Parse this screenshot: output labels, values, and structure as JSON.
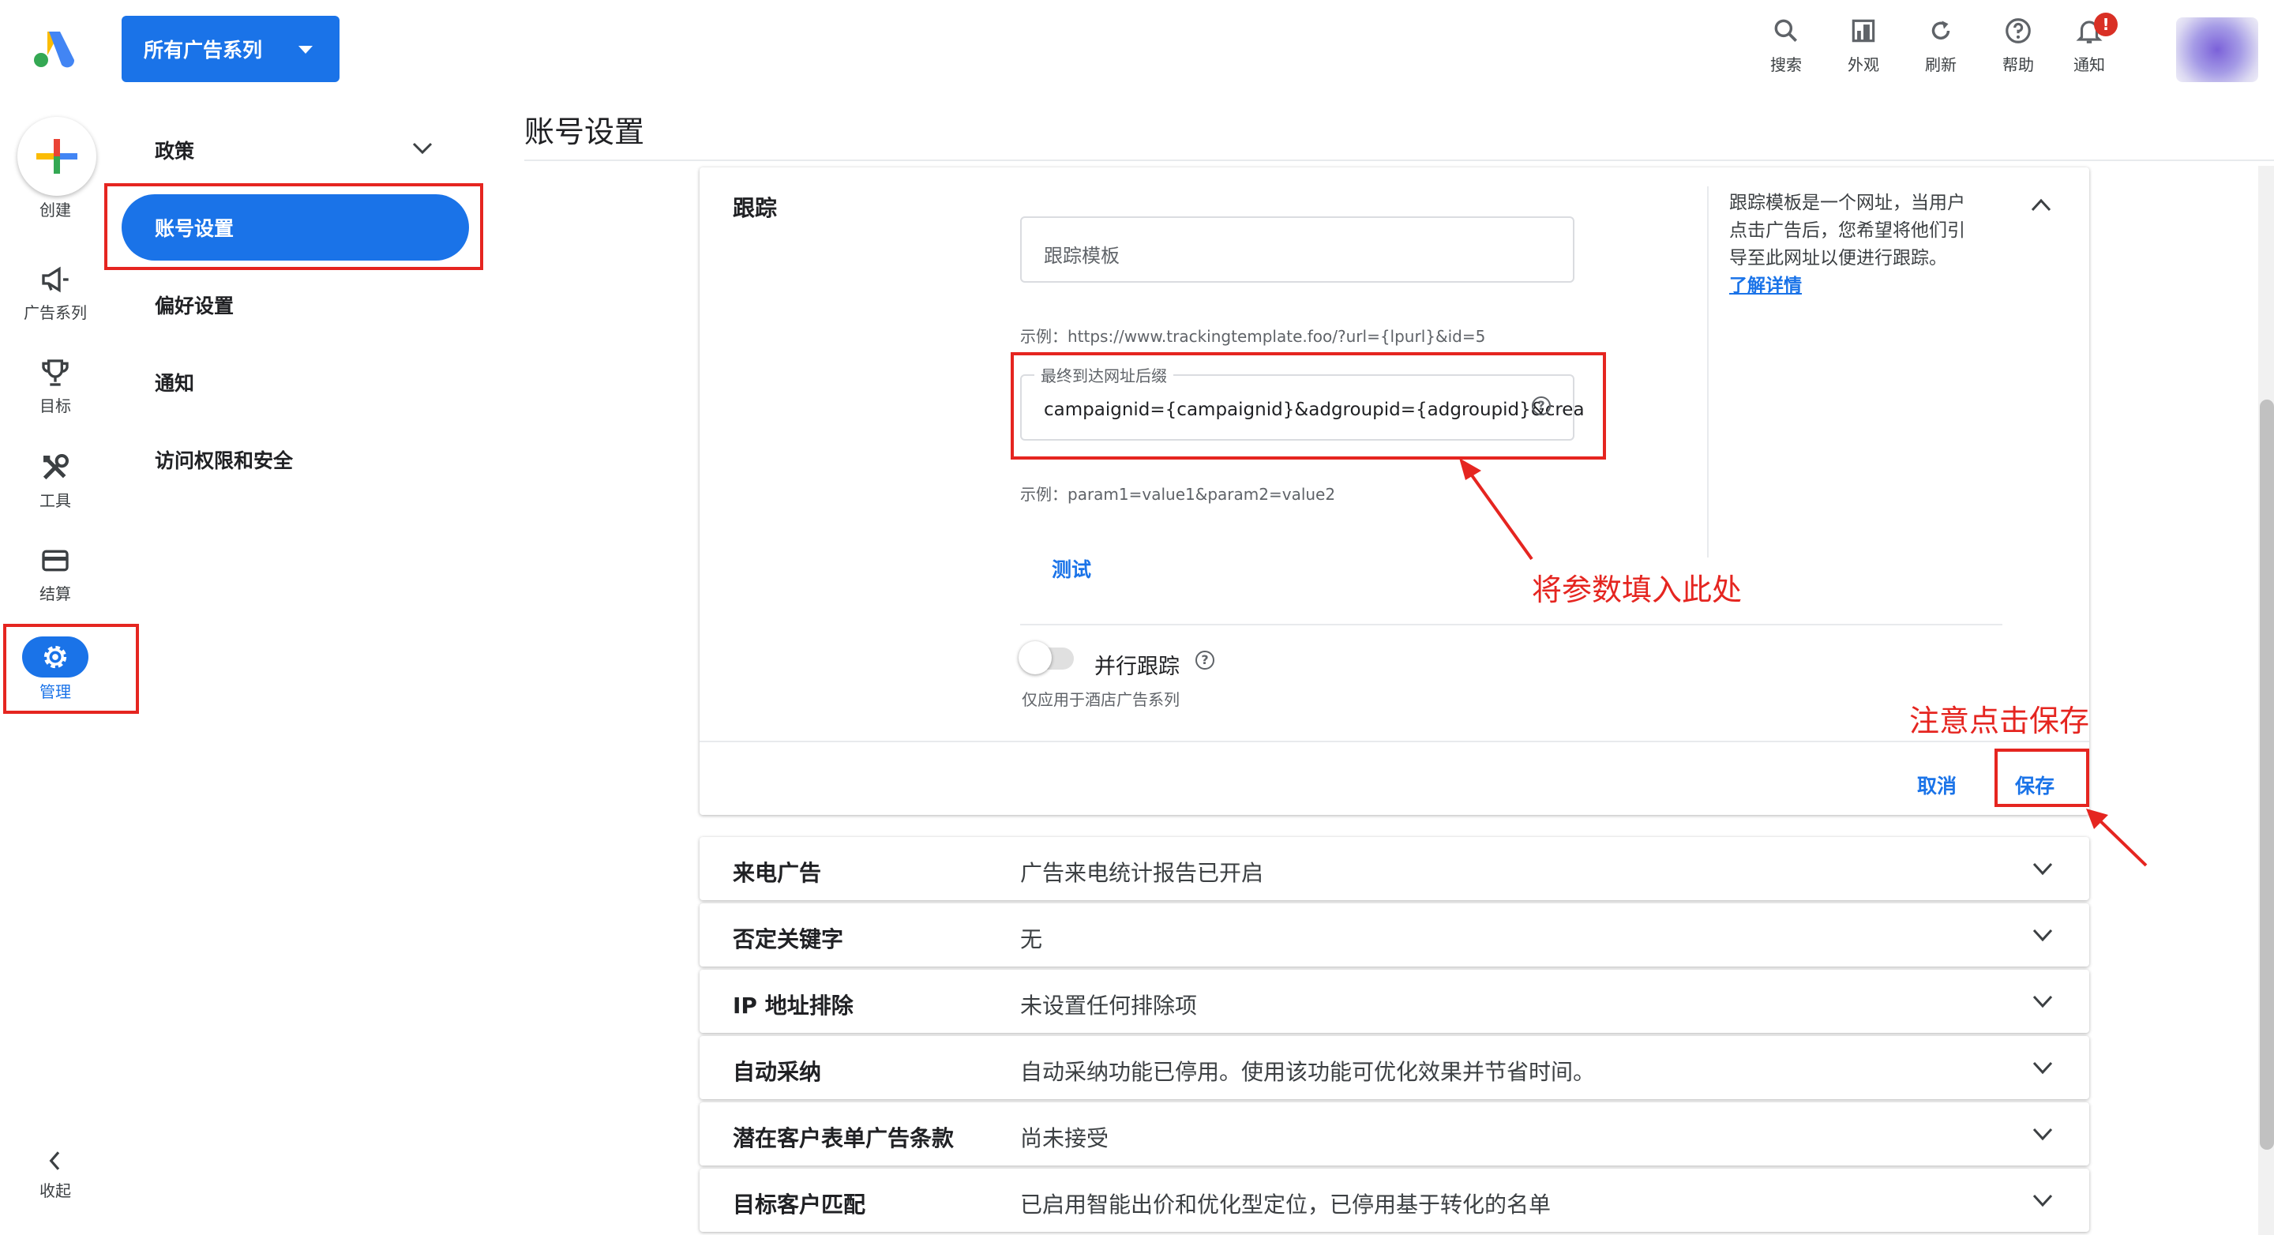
{
  "header": {
    "campaign_selector": "所有广告系列",
    "tools": [
      {
        "label": "搜索",
        "icon": "search-icon"
      },
      {
        "label": "外观",
        "icon": "appearance-icon"
      },
      {
        "label": "刷新",
        "icon": "refresh-icon"
      },
      {
        "label": "帮助",
        "icon": "help-icon"
      },
      {
        "label": "通知",
        "icon": "bell-icon"
      }
    ],
    "notification_badge": "!"
  },
  "rail": {
    "create": "创建",
    "items": [
      {
        "label": "广告系列",
        "icon": "megaphone-icon"
      },
      {
        "label": "目标",
        "icon": "trophy-icon"
      },
      {
        "label": "工具",
        "icon": "tools-icon"
      },
      {
        "label": "结算",
        "icon": "credit-card-icon"
      },
      {
        "label": "管理",
        "icon": "gear-icon"
      }
    ],
    "collapse": "收起"
  },
  "subnav": {
    "items": [
      "政策",
      "账号设置",
      "偏好设置",
      "通知",
      "访问权限和安全"
    ],
    "active": "账号设置"
  },
  "page_title": "账号设置",
  "tracking": {
    "section_label": "跟踪",
    "template_placeholder": "跟踪模板",
    "template_example": "示例：https://www.trackingtemplate.foo/?url={lpurl}&id=5",
    "suffix_label": "最终到达网址后缀",
    "suffix_value": "campaignid={campaignid}&adgroupid={adgroupid}&crea",
    "suffix_example": "示例：param1=value1&param2=value2",
    "test_button": "测试",
    "parallel_label": "并行跟踪",
    "parallel_note": "仅应用于酒店广告系列",
    "parallel_enabled": false,
    "help_text_lines": [
      "跟踪模板是一个网址，当用户",
      "点击广告后，您希望将他们引",
      "导至此网址以便进行跟踪。"
    ],
    "learn_more": "了解详情",
    "cancel": "取消",
    "save": "保存"
  },
  "annotations": {
    "fill_params": "将参数填入此处",
    "click_save": "注意点击保存",
    "color": "#e52520"
  },
  "rows": [
    {
      "label": "来电广告",
      "value": "广告来电统计报告已开启"
    },
    {
      "label": "否定关键字",
      "value": "无"
    },
    {
      "label": "IP 地址排除",
      "value": "未设置任何排除项"
    },
    {
      "label": "自动采纳",
      "value": "自动采纳功能已停用。使用该功能可优化效果并节省时间。"
    },
    {
      "label": "潜在客户表单广告条款",
      "value": "尚未接受"
    },
    {
      "label": "目标客户匹配",
      "value": "已启用智能出价和优化型定位，已停用基于转化的名单"
    }
  ],
  "colors": {
    "accent": "#1a73e8",
    "annotation": "#e52520"
  }
}
